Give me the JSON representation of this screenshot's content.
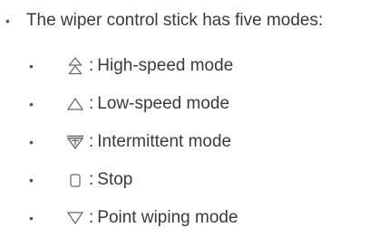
{
  "intro": {
    "bullet": "•",
    "text": "The wiper control stick has five modes:"
  },
  "modes": [
    {
      "bullet": "•",
      "icon": "double-triangle-up-icon",
      "separator": ":",
      "label": "High-speed mode"
    },
    {
      "bullet": "•",
      "icon": "triangle-up-icon",
      "separator": ":",
      "label": "Low-speed mode"
    },
    {
      "bullet": "•",
      "icon": "intermittent-wiper-icon",
      "separator": ":",
      "label": "Intermittent mode"
    },
    {
      "bullet": "•",
      "icon": "stop-square-icon",
      "separator": ":",
      "label": "Stop"
    },
    {
      "bullet": "•",
      "icon": "triangle-down-icon",
      "separator": ":",
      "label": "Point wiping mode"
    }
  ],
  "colors": {
    "text": "#3a3a3a",
    "icon_stroke": "#666666"
  }
}
